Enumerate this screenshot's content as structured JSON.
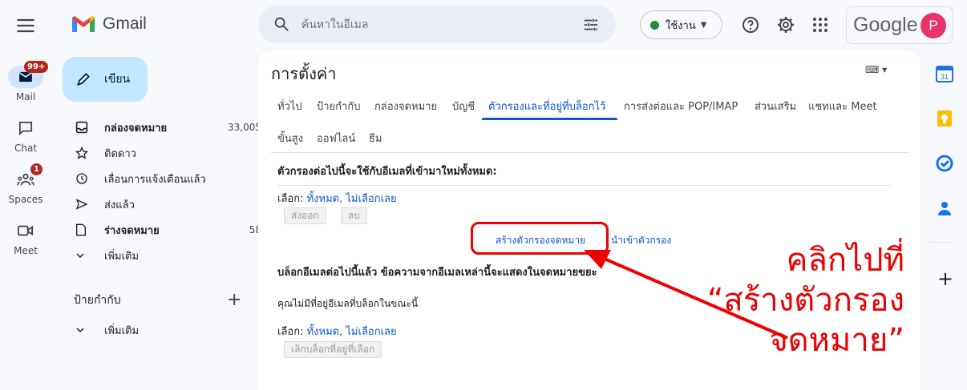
{
  "header": {
    "app_name": "Gmail",
    "search_placeholder": "ค้นหาในอีเมล",
    "status_label": "ใช้งาน",
    "google_wordmark": "Google",
    "avatar_initial": "P"
  },
  "rail": {
    "mail_label": "Mail",
    "mail_badge": "99+",
    "chat_label": "Chat",
    "spaces_label": "Spaces",
    "spaces_badge": "1",
    "meet_label": "Meet"
  },
  "compose_label": "เขียน",
  "nav": [
    {
      "label": "กล่องจดหมาย",
      "count": "33,005",
      "bold": true
    },
    {
      "label": "ติดดาว",
      "count": ""
    },
    {
      "label": "เลื่อนการแจ้งเตือนแล้ว",
      "count": ""
    },
    {
      "label": "ส่งแล้ว",
      "count": ""
    },
    {
      "label": "ร่างจดหมาย",
      "count": "58",
      "bold": true
    },
    {
      "label": "เพิ่มเติม",
      "count": ""
    }
  ],
  "labels_section": {
    "title": "ป้ายกำกับ",
    "more": "เพิ่มเติม"
  },
  "settings": {
    "title": "การตั้งค่า",
    "tabs": [
      "ทั่วไป",
      "ป้ายกำกับ",
      "กล่องจดหมาย",
      "บัญชี",
      "ตัวกรองและที่อยู่ที่บล็อกไว้",
      "การส่งต่อและ POP/IMAP",
      "ส่วนเสริม",
      "แชทและ Meet",
      "ขั้นสูง",
      "ออฟไลน์",
      "ธีม"
    ],
    "active_tab_index": 4,
    "filters_heading": "ตัวกรองต่อไปนี้จะใช้กับอีเมลที่เข้ามาใหม่ทั้งหมด:",
    "select_prefix": "เลือก:",
    "select_all": "ทั้งหมด",
    "select_none": "ไม่เลือกเลย",
    "export_button": "ส่งออก",
    "delete_button": "ลบ",
    "create_filter_link": "สร้างตัวกรองจดหมาย",
    "import_filter_link": "นำเข้าตัวกรอง",
    "blocked_heading": "บล็อกอีเมลต่อไปนี้แล้ว ข้อความจากอีเมลเหล่านี้จะแสดงในจดหมายขยะ",
    "no_blocked_text": "คุณไม่มีที่อยู่อีเมลที่บล็อกในขณะนี้",
    "unblock_button": "เลิกบล็อกที่อยู่ที่เลือก"
  },
  "annotation": {
    "lines": [
      "คลิกไปที่",
      "“สร้างตัวกรอง",
      "จดหมาย”"
    ],
    "color": "#e00000"
  },
  "colors": {
    "accent": "#0b57d0",
    "compose_bg": "#c2e7ff",
    "status_green": "#1e8e3e",
    "avatar_bg": "#e8336b"
  }
}
